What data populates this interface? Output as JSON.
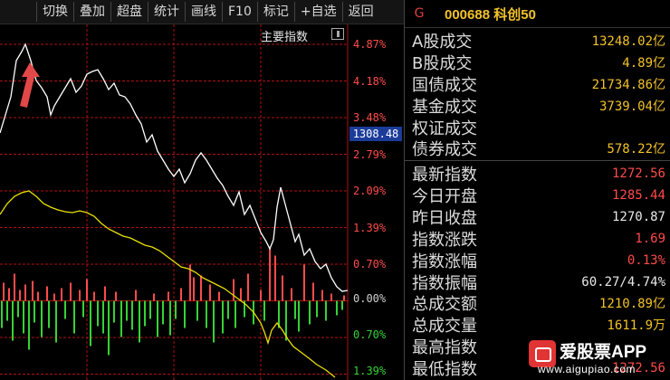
{
  "toolbar": {
    "buttons": [
      "切换",
      "叠加",
      "超盘",
      "统计",
      "画线",
      "F10",
      "标记",
      "+自选",
      "返回"
    ]
  },
  "chart": {
    "main_index_label": "主要指数",
    "price_tag": "1308.48",
    "pct_labels": [
      "4.87%",
      "4.18%",
      "3.48%",
      "2.79%",
      "2.09%",
      "1.39%",
      "0.70%",
      "0.00%",
      "0.70%",
      "1.39%"
    ],
    "colors": {
      "up": "#ff4b4b",
      "down": "#36d236",
      "grid": "#b01010",
      "price_line": "#ffffff",
      "avg_line": "#e8e000",
      "arrow": "#e24848"
    }
  },
  "chart_data": {
    "type": "line",
    "x": [
      0,
      8,
      16,
      24,
      32,
      40,
      48,
      56,
      64,
      72,
      80,
      88,
      96,
      104,
      112,
      120,
      128,
      136,
      144,
      152,
      160,
      168,
      176,
      184,
      192,
      200,
      208,
      216,
      224,
      232,
      240,
      248,
      256,
      264,
      272,
      280,
      288,
      296,
      304,
      312,
      320,
      328,
      336,
      344,
      352,
      360,
      368,
      376,
      384
    ],
    "series": [
      {
        "values": [
          0.78,
          0.8,
          0.82,
          0.85,
          0.86,
          0.84,
          0.8,
          0.78,
          0.8,
          0.8,
          0.78,
          0.79,
          0.8,
          0.81,
          0.8,
          0.79,
          0.77,
          0.75,
          0.73,
          0.72,
          0.71,
          0.7,
          0.68,
          0.66,
          0.64,
          0.63,
          0.63,
          0.62,
          0.6,
          0.58,
          0.58,
          0.57,
          0.56,
          0.55,
          0.53,
          0.52,
          0.51,
          0.5,
          0.49,
          0.5,
          0.47,
          0.45,
          0.42,
          0.38,
          0.36,
          0.34,
          0.32,
          0.29,
          0.25
        ]
      },
      {
        "values": [
          0.68,
          0.72,
          0.75,
          0.78,
          0.77,
          0.76,
          0.74,
          0.72,
          0.7,
          0.69,
          0.68,
          0.67,
          0.66,
          0.65,
          0.64,
          0.63,
          0.62,
          0.6,
          0.58,
          0.57,
          0.56,
          0.55,
          0.54,
          0.52,
          0.51,
          0.5,
          0.49,
          0.48,
          0.47,
          0.46,
          0.45,
          0.44,
          0.43,
          0.41,
          0.39,
          0.37,
          0.35,
          0.33,
          0.32,
          0.31,
          0.3,
          0.29,
          0.28,
          0.27,
          0.26,
          0.25,
          0.24,
          0.23,
          0.22
        ]
      }
    ],
    "ylabels": [
      "4.87%",
      "4.18%",
      "3.48%",
      "2.79%",
      "2.09%",
      "1.39%",
      "0.70%",
      "0.00%",
      "0.70%",
      "1.39%"
    ]
  },
  "panel": {
    "header_icon": "G",
    "code_name": "000688 科创50",
    "rows": [
      {
        "label": "A股成交",
        "value": "13248.02亿",
        "color": "yellow"
      },
      {
        "label": "B股成交",
        "value": "4.89亿",
        "color": "yellow"
      },
      {
        "label": "国债成交",
        "value": "21734.86亿",
        "color": "yellow"
      },
      {
        "label": "基金成交",
        "value": "3739.04亿",
        "color": "yellow"
      },
      {
        "label": "权证成交",
        "value": "",
        "color": "yellow"
      },
      {
        "label": "债券成交",
        "value": "578.22亿",
        "color": "yellow"
      },
      {
        "label": "最新指数",
        "value": "1272.56",
        "color": "red"
      },
      {
        "label": "今日开盘",
        "value": "1285.44",
        "color": "red"
      },
      {
        "label": "昨日收盘",
        "value": "1270.87",
        "color": "white"
      },
      {
        "label": "指数涨跌",
        "value": "1.69",
        "color": "red"
      },
      {
        "label": "指数涨幅",
        "value": "0.13%",
        "color": "red"
      },
      {
        "label": "指数振幅",
        "value": "60.27/4.74%",
        "color": "white"
      },
      {
        "label": "总成交额",
        "value": "1210.89亿",
        "color": "yellow"
      },
      {
        "label": "总成交量",
        "value": "1611.9万",
        "color": "yellow"
      },
      {
        "label": "最高指数",
        "value": "",
        "color": "red"
      },
      {
        "label": "最低指数",
        "value": "1272.56",
        "color": "red"
      }
    ]
  },
  "watermark": {
    "title": "爱股票APP",
    "url": "www.aigupiao.com"
  }
}
